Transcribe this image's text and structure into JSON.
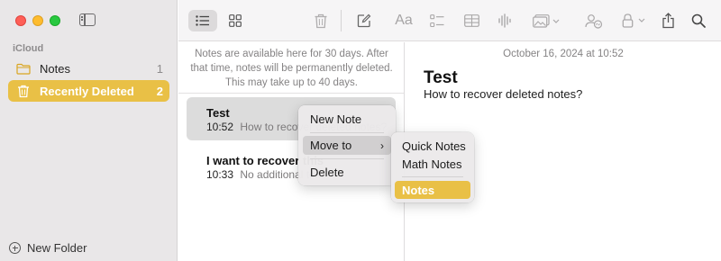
{
  "sidebar": {
    "section_label": "iCloud",
    "items": [
      {
        "label": "Notes",
        "count": "1"
      },
      {
        "label": "Recently Deleted",
        "count": "2"
      }
    ],
    "new_folder_label": "New Folder"
  },
  "toolbar": {
    "format_label": "Aa",
    "icons": [
      "list-view-icon",
      "gallery-view-icon",
      "trash-icon",
      "compose-icon",
      "format-icon",
      "checklist-icon",
      "table-icon",
      "audio-icon",
      "media-icon",
      "collaborate-icon",
      "lock-icon",
      "share-icon",
      "search-icon"
    ]
  },
  "notelist": {
    "notice": "Notes are available here for 30 days. After that time, notes will be permanently deleted. This may take up to 40 days.",
    "notes": [
      {
        "title": "Test",
        "time": "10:52",
        "preview": "How to recover deleted notes?"
      },
      {
        "title": "I want to recover this",
        "time": "10:33",
        "preview": "No additional text"
      }
    ]
  },
  "editor": {
    "date": "October 16, 2024 at 10:52",
    "title": "Test",
    "body": "How to recover deleted notes?"
  },
  "context_menu": {
    "items": [
      "New Note",
      "Move to",
      "Delete"
    ],
    "submenu": [
      "Quick Notes",
      "Math Notes",
      "Notes"
    ]
  },
  "colors": {
    "accent": "#e9c046",
    "sidebar_bg": "#e9e7e8"
  }
}
